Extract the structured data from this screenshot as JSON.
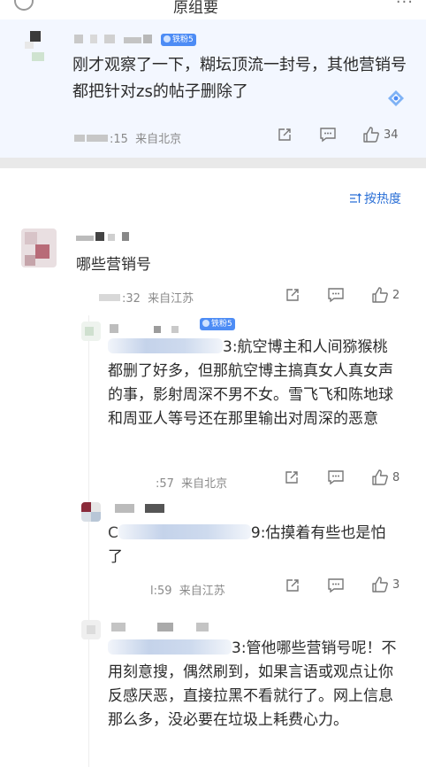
{
  "header": {
    "title": "原组要"
  },
  "main_comment": {
    "badge": "铁粉5",
    "text": "刚才观察了一下，糊坛顶流一封号，其他营销号都把针对zs的帖子删除了",
    "time": ":15",
    "location": "来自北京",
    "likes": "34"
  },
  "sort_label": "按热度",
  "comments": [
    {
      "text": "哪些营销号",
      "time": ":32",
      "location": "来自江苏",
      "likes": "2"
    }
  ],
  "replies": [
    {
      "badge": "铁粉5",
      "lead_suffix": "3:",
      "text": "航空博主和人间猕猴桃都删了好多，但那航空博主搞真女人真女声的事，影射周深不男不女。雪飞飞和陈地球和周亚人等号还在那里输出对周深的恶意",
      "time": ":57",
      "location": "来自北京",
      "likes": "8"
    },
    {
      "lead_suffix": "9:",
      "text": "估摸着有些也是怕了",
      "time": "l:59",
      "location": "来自江苏",
      "likes": "3"
    },
    {
      "lead_suffix": "3:",
      "text": "管他哪些营销号呢！不用刻意搜，偶然刷到，如果言语或观点让你反感厌恶，直接拉黑不看就行了。网上信息那么多，没必要在垃圾上耗费心力。"
    }
  ],
  "icons": {
    "share": "share-icon",
    "comment": "comment-icon",
    "like": "thumbs-up-icon",
    "sort": "sort-icon"
  },
  "colors": {
    "badge": "#4d8cf5",
    "link": "#2a6fd6",
    "highlight_bg": "#f3f7ff"
  }
}
